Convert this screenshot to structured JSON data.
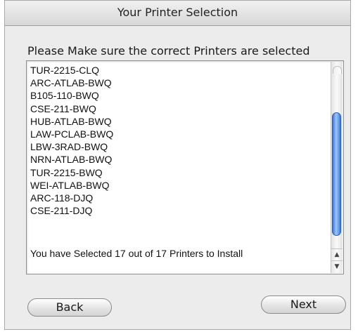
{
  "window": {
    "title": "Your Printer Selection"
  },
  "prompt": "Please Make sure the correct Printers are selected",
  "printers": [
    "TUR-2215-CLQ",
    "ARC-ATLAB-BWQ",
    "B105-110-BWQ",
    "CSE-211-BWQ",
    "HUB-ATLAB-BWQ",
    "LAW-PCLAB-BWQ",
    "LBW-3RAD-BWQ",
    "NRN-ATLAB-BWQ",
    "TUR-2215-BWQ",
    "WEI-ATLAB-BWQ",
    "ARC-118-DJQ",
    "CSE-211-DJQ"
  ],
  "status": "You have Selected 17 out of 17 Printers to Install",
  "buttons": {
    "back": "Back",
    "next": "Next"
  },
  "icons": {
    "scroll_up": "arrow-up-icon",
    "scroll_down": "arrow-down-icon"
  },
  "colors": {
    "scroll_thumb": "#5a92e4",
    "window_bg": "#ececec"
  }
}
